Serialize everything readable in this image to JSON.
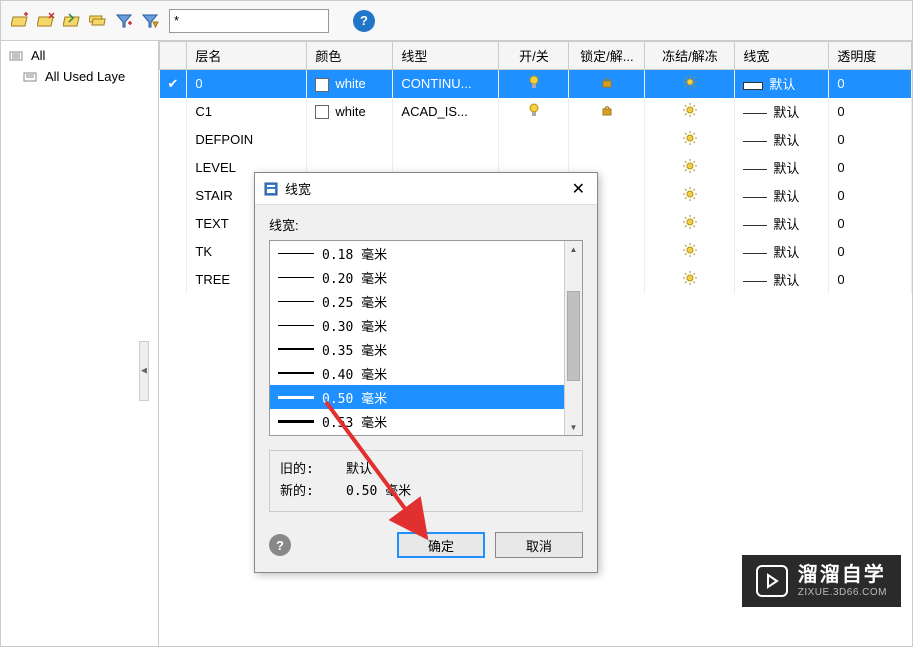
{
  "toolbar": {
    "filter_value": "*"
  },
  "sidebar": {
    "items": [
      {
        "label": "All"
      },
      {
        "label": "All Used Laye"
      }
    ]
  },
  "table": {
    "headers": [
      "层名",
      "颜色",
      "线型",
      "开/关",
      "锁定/解...",
      "冻结/解冻",
      "线宽",
      "透明度"
    ],
    "rows": [
      {
        "name": "0",
        "color": "white",
        "linetype": "CONTINU...",
        "lw": "默认",
        "trans": "0",
        "selected": true,
        "dialogHidden": false
      },
      {
        "name": "C1",
        "color": "white",
        "linetype": "ACAD_IS...",
        "lw": "默认",
        "trans": "0",
        "selected": false,
        "dialogHidden": false
      },
      {
        "name": "DEFPOIN",
        "color": "",
        "linetype": "",
        "lw": "默认",
        "trans": "0",
        "selected": false,
        "dialogHidden": true
      },
      {
        "name": "LEVEL",
        "color": "",
        "linetype": "",
        "lw": "默认",
        "trans": "0",
        "selected": false,
        "dialogHidden": true
      },
      {
        "name": "STAIR",
        "color": "",
        "linetype": "",
        "lw": "默认",
        "trans": "0",
        "selected": false,
        "dialogHidden": true
      },
      {
        "name": "TEXT",
        "color": "",
        "linetype": "",
        "lw": "默认",
        "trans": "0",
        "selected": false,
        "dialogHidden": true
      },
      {
        "name": "TK",
        "color": "",
        "linetype": "",
        "lw": "默认",
        "trans": "0",
        "selected": false,
        "dialogHidden": true
      },
      {
        "name": "TREE",
        "color": "",
        "linetype": "",
        "lw": "默认",
        "trans": "0",
        "selected": false,
        "dialogHidden": true
      }
    ]
  },
  "dialog": {
    "title": "线宽",
    "label": "线宽:",
    "items": [
      {
        "label": "0.18 毫米",
        "w": 1
      },
      {
        "label": "0.20 毫米",
        "w": 1
      },
      {
        "label": "0.25 毫米",
        "w": 1
      },
      {
        "label": "0.30 毫米",
        "w": 1
      },
      {
        "label": "0.35 毫米",
        "w": 2
      },
      {
        "label": "0.40 毫米",
        "w": 2
      },
      {
        "label": "0.50 毫米",
        "w": 3,
        "selected": true
      },
      {
        "label": "0.53 毫米",
        "w": 3
      }
    ],
    "old_label": "旧的:",
    "old_value": "默认",
    "new_label": "新的:",
    "new_value": "0.50 毫米",
    "ok": "确定",
    "cancel": "取消"
  },
  "watermark": {
    "main": "溜溜自学",
    "sub": "ZIXUE.3D66.COM"
  }
}
